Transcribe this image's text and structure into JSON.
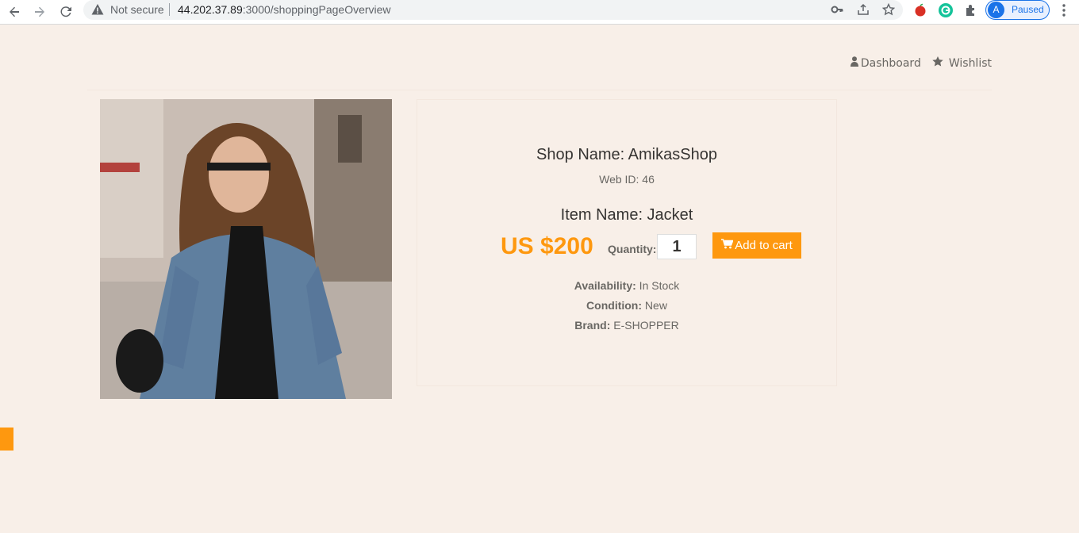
{
  "browser": {
    "security_label": "Not secure",
    "url_host": "44.202.37.89",
    "url_rest": ":3000/shoppingPageOverview",
    "profile_initial": "A",
    "profile_status": "Paused"
  },
  "nav": {
    "dashboard": "Dashboard",
    "wishlist": "Wishlist"
  },
  "product": {
    "shop_name": "Shop Name: AmikasShop",
    "web_id": "Web ID: 46",
    "item_name": "Item Name: Jacket",
    "price": "US $200",
    "quantity_label": "Quantity:",
    "quantity_value": "1",
    "add_to_cart": "Add to cart",
    "availability_label": "Availability:",
    "availability_value": " In Stock",
    "condition_label": "Condition:",
    "condition_value": " New",
    "brand_label": "Brand:",
    "brand_value": " E-SHOPPER"
  },
  "colors": {
    "accent": "#fe980f",
    "background": "#f8efe8"
  }
}
